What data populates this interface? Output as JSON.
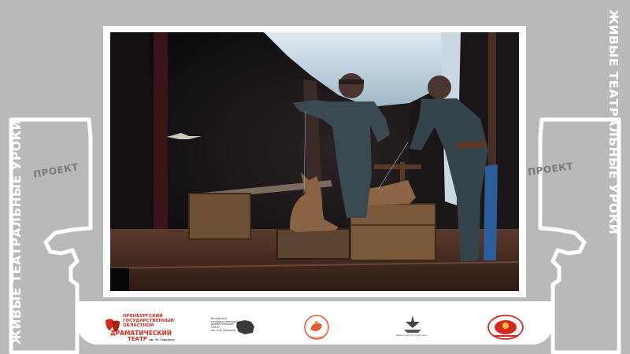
{
  "project": {
    "title_vertical": "ЖИВЫЕ ТЕАТРАЛЬНЫЕ УРОКИ",
    "label": "ПРОЕКТ"
  },
  "photo": {
    "subject": "Stage scene: two performers in aviator outfits with dog puppets on wooden crates"
  },
  "logos": {
    "orenburg_drama": {
      "line1": "ОРЕНБУРГСКИЙ",
      "line2": "ГОСУДАРСТВЕННЫЙ",
      "line3": "ОБЛАСТНОЙ",
      "line4": "ДРАМАТИЧЕСКИЙ",
      "line5": "ТЕАТР",
      "line6": "им. М. Горького"
    },
    "kuprin_theatre": {
      "line1": "Валуйский",
      "line2": "государственный",
      "line3": "драматический",
      "line4": "театр",
      "line5": "им. А.И. Куприна"
    },
    "ministry": {
      "line1": "Министерство культуры"
    }
  },
  "colors": {
    "background": "#b9b9b9",
    "accent_red": "#d42a1e",
    "frame": "#ffffff"
  }
}
